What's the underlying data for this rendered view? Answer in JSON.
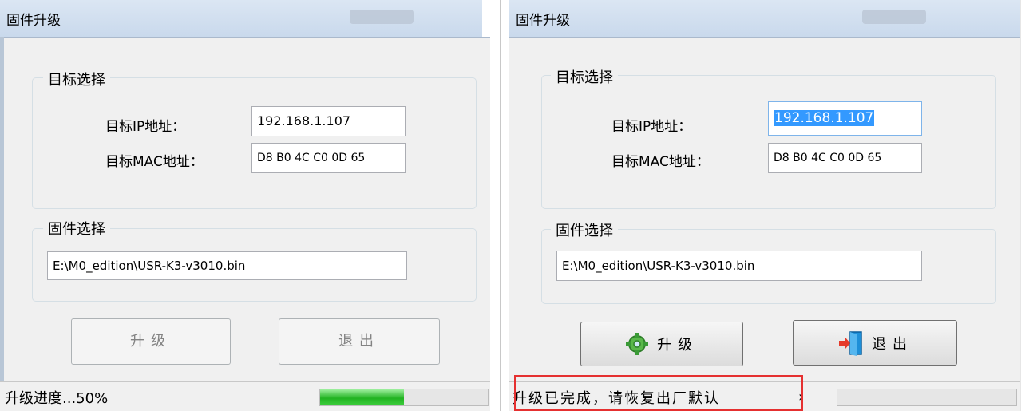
{
  "left": {
    "window_title": "固件升级",
    "target_group": {
      "legend": "目标选择",
      "ip_label": "目标IP地址：",
      "ip_value": "192.168.1.107",
      "mac_label": "目标MAC地址：",
      "mac_value": "D8 B0 4C C0 0D 65"
    },
    "firmware_group": {
      "legend": "固件选择",
      "path_value": "E:\\M0_edition\\USR-K3-v3010.bin"
    },
    "upgrade_label": "升级",
    "exit_label": "退出",
    "status_text": "升级进度...50%",
    "progress_fraction": 0.5
  },
  "right": {
    "window_title": "固件升级",
    "target_group": {
      "legend": "目标选择",
      "ip_label": "目标IP地址：",
      "ip_value": "192.168.1.107",
      "mac_label": "目标MAC地址：",
      "mac_value": "D8 B0 4C C0 0D 65"
    },
    "firmware_group": {
      "legend": "固件选择",
      "path_value": "E:\\M0_edition\\USR-K3-v3010.bin"
    },
    "upgrade_label": "升级",
    "upgrade_icon": "gear-icon",
    "exit_label": "退出",
    "exit_icon": "exit-door-icon",
    "status_text": "升级已完成，请恢复出厂默认",
    "progress_fraction": 0.0
  },
  "colors": {
    "highlight": "#e53030",
    "progress_green": "#22b322",
    "selection": "#3399ff"
  }
}
